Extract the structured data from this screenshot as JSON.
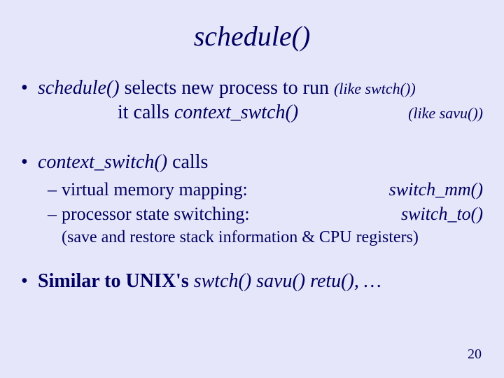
{
  "title": "schedule()",
  "b1": {
    "l1_a": "schedule()",
    "l1_b": " selects new process  to run ",
    "l1_c": "(like swtch())",
    "l2_a": "it calls ",
    "l2_b": "context_swtch()",
    "l2_c": "(like savu())"
  },
  "b2": {
    "head_a": "context_switch()",
    "head_b": " calls",
    "s1_left": "virtual memory mapping:",
    "s1_right": "switch_mm()",
    "s2_left": "processor state switching:",
    "s2_right": "switch_to()",
    "note": "(save and restore stack information & CPU registers)"
  },
  "b3": {
    "a": "Similar to UNIX's ",
    "b": "  swtch()  savu()  retu(), …"
  },
  "page": "20"
}
